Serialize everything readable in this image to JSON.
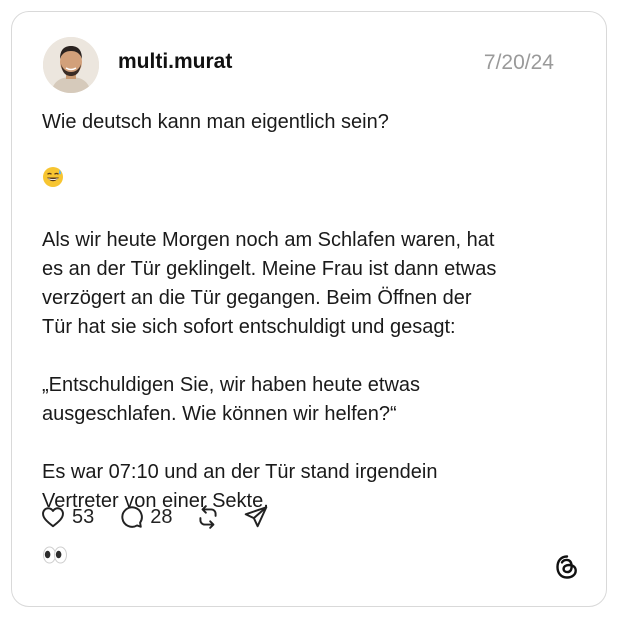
{
  "post": {
    "username": "multi.murat",
    "date": "7/20/24",
    "paragraphs": [
      "Wie deutsch kann man eigentlich sein?",
      "Als wir heute Morgen noch am Schlafen waren, hat\nes an der Tür geklingelt. Meine Frau ist dann etwas\nverzögert an die Tür gegangen. Beim Öffnen der\nTür hat sie sich sofort entschuldigt und gesagt:",
      "„Entschuldigen Sie, wir haben heute etwas\nausgeschlafen. Wie können wir helfen?“",
      "Es war 07:10 und an der Tür stand irgendein\nVertreter von einer Sekte."
    ],
    "emojis": [
      "grinning-sweat-emoji",
      "eyes-emoji"
    ]
  },
  "actions": {
    "likes": "53",
    "replies": "28",
    "like_icon": "heart-icon",
    "reply_icon": "speech-bubble-icon",
    "repost_icon": "repost-icon",
    "share_icon": "send-icon"
  },
  "brand": {
    "logo_icon": "threads-logo-icon"
  }
}
